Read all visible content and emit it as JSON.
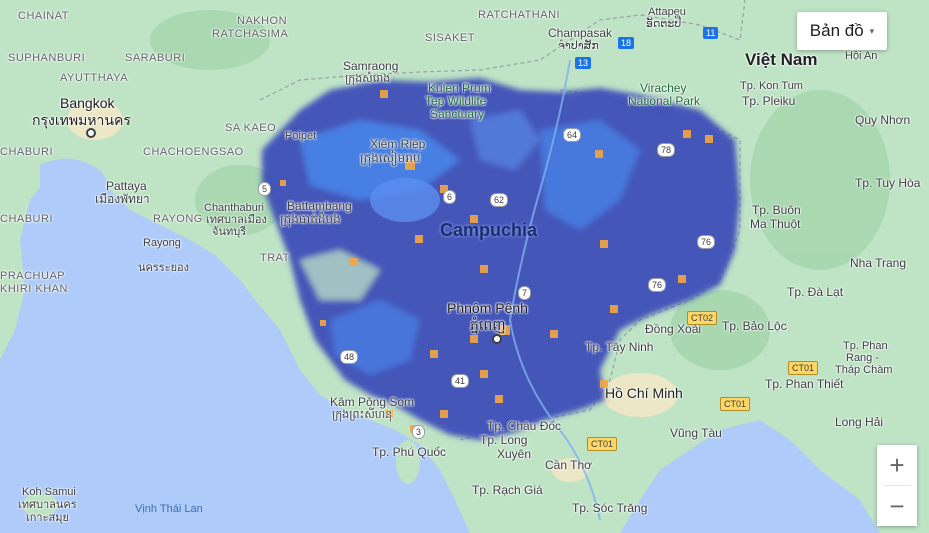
{
  "map_type_control": {
    "label": "Bản đồ",
    "caret": "▾"
  },
  "zoom": {
    "in_label": "+",
    "out_label": "−"
  },
  "colors": {
    "sea": "#aecbfa",
    "land": "#bfe3c5",
    "coverage_dark": "#3b49b8",
    "coverage_light": "#4a8cf0",
    "hotspot": "#f4a640"
  },
  "labels": {
    "vietnam": "Việt Nam",
    "cambodia": "Campuchia",
    "phnom_penh": "Phnôm Pênh",
    "phnom_penh_km": "ភ្នំពេញ",
    "bangkok": "Bangkok",
    "bangkok_th": "กรุงเทพมหานคร",
    "suphanburi": "SUPHANBURI",
    "ayutthaya": "AYUTTHAYA",
    "saraburi": "SARABURI",
    "chainat": "CHAINAT",
    "nakhon": "NAKHON",
    "ratchasima": "RATCHASIMA",
    "sisaket": "SISAKET",
    "ratchathani": "RATCHATHANI",
    "sa_kaeo": "SA KAEO",
    "chachoengsao": "CHACHOENGSAO",
    "chaburi_1": "CHABURI",
    "chaburi_2": "CHABURI",
    "rayong_region": "RAYONG",
    "trat": "TRAT",
    "prachuap": "PRACHUAP",
    "khiri_khan": "KHIRI KHAN",
    "pattaya": "Pattaya",
    "pattaya_th": "เมืองพัทยา",
    "chanthaburi": "Chanthaburi",
    "chanthaburi_th_1": "เทศบาลเมือง",
    "chanthaburi_th_2": "จันทบุรี",
    "rayong": "Rayong",
    "rayong_th": "นครระยอง",
    "samraong": "Samraong",
    "samraong_km": "ក្រុងសំរោង",
    "kulen": "Kulen Prum",
    "kulen2": "Tep Wildlife",
    "kulen3": "Sanctuary",
    "siem_reap": "Xiêm Riệp",
    "siem_reap_km": "ក្រុងសៀមរាប",
    "poipet": "Poipet",
    "battambang": "Battambang",
    "battambang_km": "ក្រុងបាត់ដំបង",
    "champasak": "Champasak",
    "champasak_lo": "ຈຳປາສັກ",
    "attapeu": "Attapeu",
    "attapeu_lo": "ອັດຕະປື",
    "virachey": "Virachey",
    "virachey2": "National Park",
    "hoi_an": "Hội An",
    "kon_tum": "Tp. Kon Tum",
    "pleiku": "Tp. Pleiku",
    "quy_nhon": "Quy Nhơn",
    "tuy_hoa": "Tp. Tuy Hòa",
    "buon_ma_thuot_1": "Tp. Buôn",
    "buon_ma_thuot_2": "Ma Thuột",
    "nha_trang": "Nha Trang",
    "da_lat": "Tp. Đà Lạt",
    "dong_xoai": "Đồng Xoài",
    "bao_loc": "Tp. Bảo Lộc",
    "tay_ninh": "Tp. Tây Ninh",
    "phan_rang_1": "Tp. Phan",
    "phan_rang_2": "Rang -",
    "phan_rang_3": "Tháp Chàm",
    "ho_chi_minh": "Hồ Chí Minh",
    "phan_thiet": "Tp. Phan Thiết",
    "long_hai": "Long Hải",
    "vung_tau": "Vũng Tàu",
    "kampong_som": "Kâm Pông Som",
    "kampong_som_km": "ក្រុងព្រះសីហនុ",
    "chau_doc": "Tp. Châu Đốc",
    "long_xuyen_1": "Tp. Long",
    "long_xuyen_2": "Xuyên",
    "phu_quoc": "Tp. Phú Quốc",
    "can_tho": "Cần Thơ",
    "rach_gia": "Tp. Rạch Giá",
    "soc_trang": "Tp. Sóc Trăng",
    "koh_samui": "Koh Samui",
    "koh_samui_th_1": "เทศบาลนคร",
    "koh_samui_th_2": "เกาะสมุย",
    "gulf": "Vịnh Thái Lan"
  },
  "road_shields": {
    "r13": "13",
    "r18": "18",
    "r11": "11",
    "r64": "64",
    "r78": "78",
    "r76": "76",
    "r76b": "76",
    "r5": "5",
    "r62": "62",
    "r6": "6",
    "r7": "7",
    "r48": "48",
    "r41": "41",
    "r3": "3",
    "r57": "57",
    "ct02": "CT02",
    "ct01a": "CT01",
    "ct01b": "CT01",
    "ct01c": "CT01"
  }
}
